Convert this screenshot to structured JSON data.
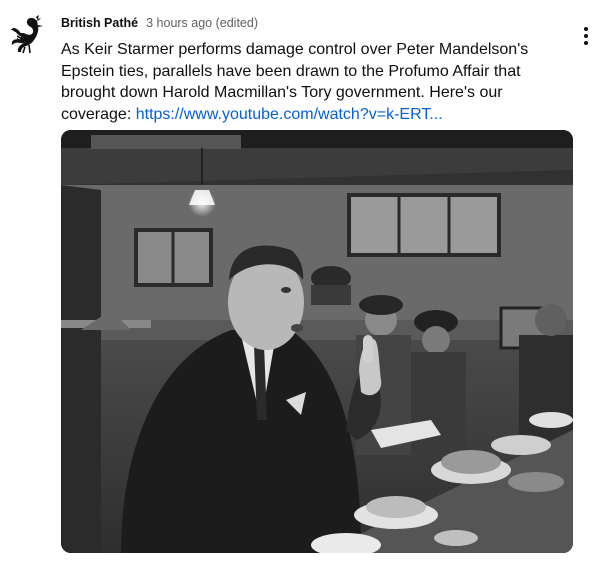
{
  "post": {
    "channel_name": "British Pathé",
    "timestamp": "3 hours ago (edited)",
    "text": "As Keir Starmer performs damage control over Peter Mandelson's Epstein ties, parallels have been drawn to the Profumo Affair that brought down Harold Macmillan's Tory government. Here's our coverage: ",
    "link_text": "https://www.youtube.com/watch?v=k-ERT...",
    "avatar_icon": "rooster-logo-icon",
    "menu_icon": "more-vert-icon",
    "image_icon": "black-and-white-photo"
  },
  "colors": {
    "link": "#065fd4",
    "text": "#0f0f0f",
    "meta": "#606060"
  }
}
